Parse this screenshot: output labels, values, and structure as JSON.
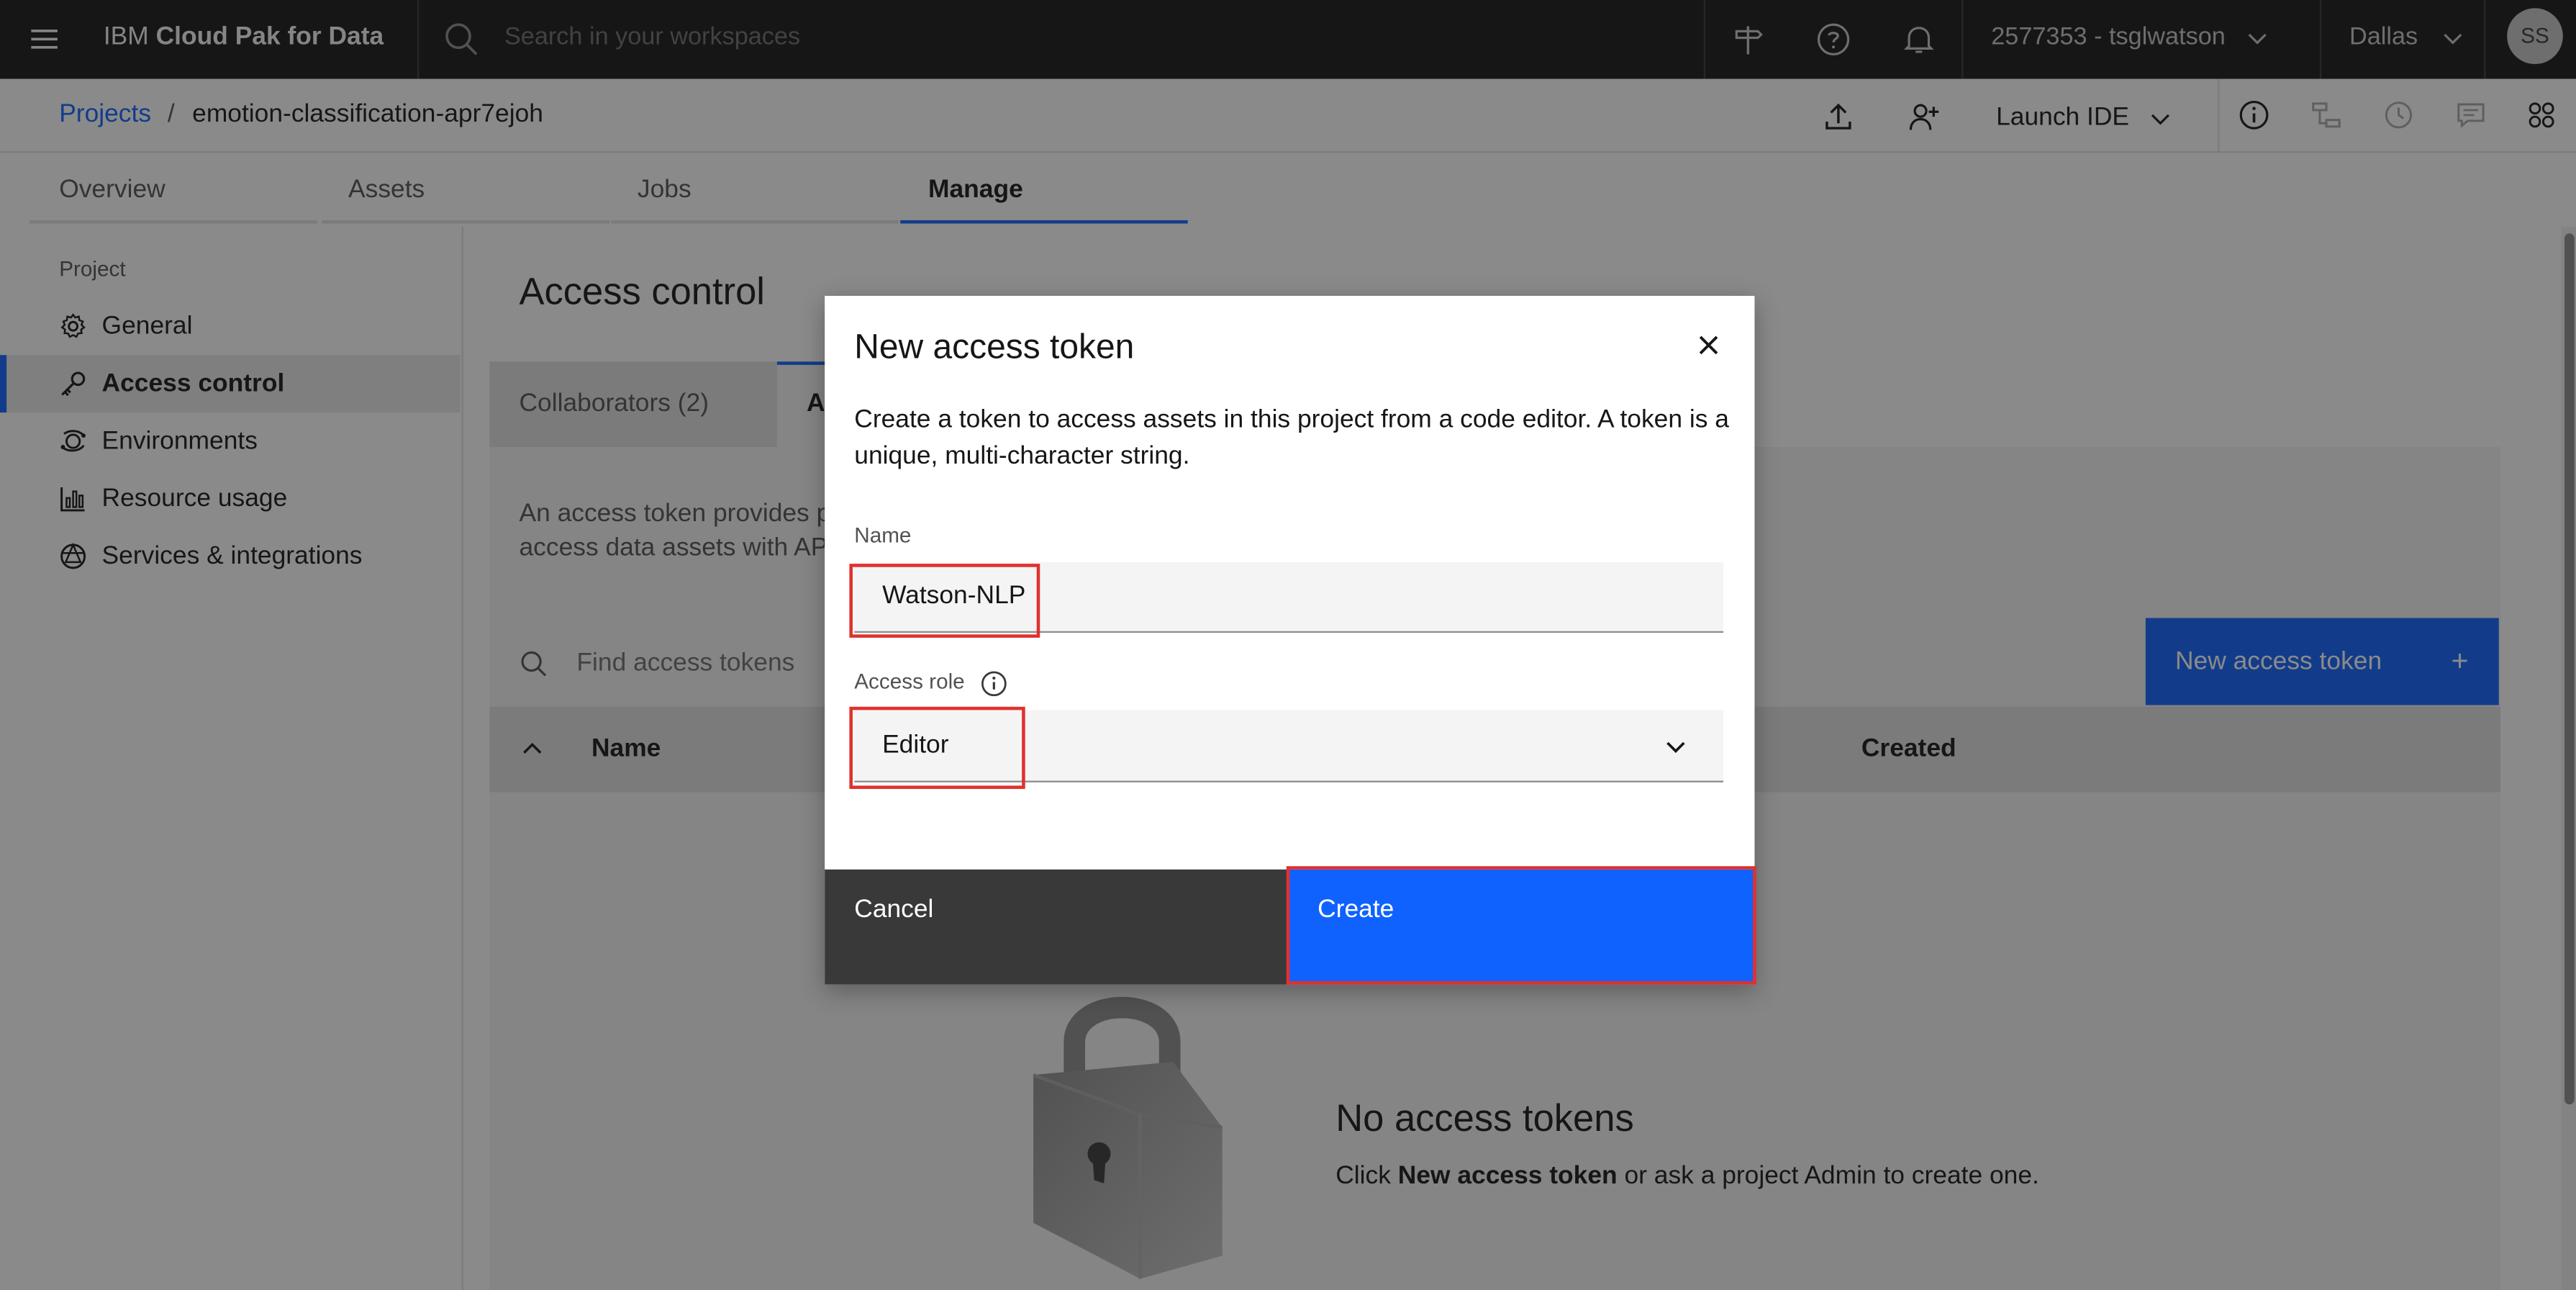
{
  "app": {
    "name_prefix": "IBM",
    "name_bold": "Cloud Pak for Data",
    "search_placeholder": "Search in your workspaces",
    "account": "2577353 - tsglwatson",
    "region": "Dallas",
    "avatar_initials": "SS"
  },
  "breadcrumb": {
    "root": "Projects",
    "separator": "/",
    "current": "emotion-classification-apr7ejoh"
  },
  "toolbar": {
    "launch_ide": "Launch IDE"
  },
  "tabs": [
    {
      "label": "Overview"
    },
    {
      "label": "Assets"
    },
    {
      "label": "Jobs"
    },
    {
      "label": "Manage",
      "selected": true
    }
  ],
  "sidebar": {
    "heading": "Project",
    "items": [
      {
        "label": "General",
        "icon": "gear-icon"
      },
      {
        "label": "Access control",
        "icon": "key-icon",
        "selected": true
      },
      {
        "label": "Environments",
        "icon": "environment-icon"
      },
      {
        "label": "Resource usage",
        "icon": "chart-icon"
      },
      {
        "label": "Services & integrations",
        "icon": "integrations-icon"
      }
    ]
  },
  "main": {
    "title": "Access control",
    "subtabs": [
      {
        "label": "Collaborators (2)"
      },
      {
        "label": "A",
        "selected": true
      }
    ],
    "description_line1": "An access token provides p",
    "description_line2": "access data assets with AP",
    "find_placeholder": "Find access tokens",
    "new_token_button": "New access token",
    "new_token_plus": "+",
    "table_headers": {
      "name": "Name",
      "created": "Created"
    },
    "empty_title": "No access tokens",
    "empty_text_prefix": "Click ",
    "empty_text_bold": "New access token",
    "empty_text_suffix": " or ask a project Admin to create one."
  },
  "modal": {
    "title": "New access token",
    "description": "Create a token to access assets in this project from a code editor. A token is a unique, multi-character string.",
    "name_label": "Name",
    "name_value": "Watson-NLP",
    "role_label": "Access role",
    "role_value": "Editor",
    "cancel_label": "Cancel",
    "create_label": "Create"
  },
  "colors": {
    "primary": "#0f62fe",
    "header_bg": "#161616",
    "highlight_box": "#e0312f"
  }
}
